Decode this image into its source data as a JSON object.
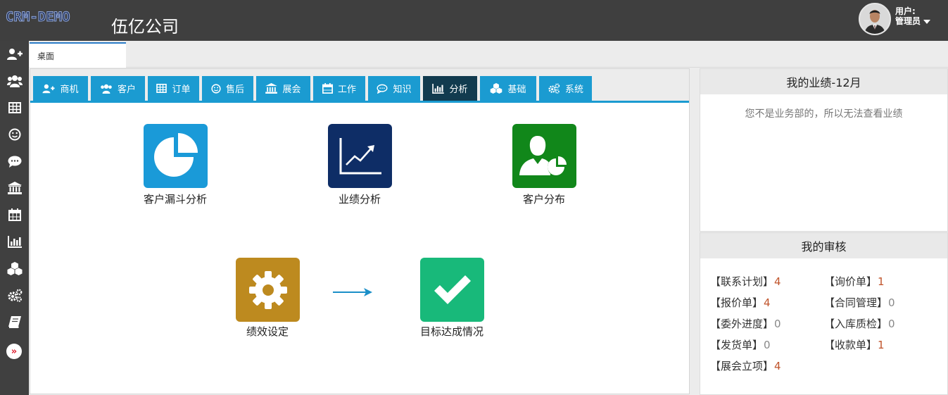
{
  "header": {
    "logo": "CRM-DEMO",
    "company": "伍亿公司",
    "user_label": "用户:",
    "user_name": "管理员"
  },
  "rail": {
    "icons": [
      "user-plus-icon",
      "users-icon",
      "table-icon",
      "smile-icon",
      "comment-icon",
      "bank-icon",
      "calendar-icon",
      "bar-chart-icon",
      "cubes-icon",
      "cogs-icon",
      "book-icon"
    ],
    "toggle": "»"
  },
  "tabs": {
    "desktop": "桌面"
  },
  "modules": [
    {
      "label": "商机",
      "icon": "user-plus-icon"
    },
    {
      "label": "客户",
      "icon": "users-icon"
    },
    {
      "label": "订单",
      "icon": "table-icon"
    },
    {
      "label": "售后",
      "icon": "smile-icon"
    },
    {
      "label": "展会",
      "icon": "bank-icon"
    },
    {
      "label": "工作",
      "icon": "calendar-icon"
    },
    {
      "label": "知识",
      "icon": "comment-icon"
    },
    {
      "label": "分析",
      "icon": "bar-chart-icon",
      "active": true
    },
    {
      "label": "基础",
      "icon": "cubes-icon"
    },
    {
      "label": "系统",
      "icon": "cogs-icon"
    }
  ],
  "analysis": {
    "funnel": "客户漏斗分析",
    "performance": "业绩分析",
    "distribution": "客户分布",
    "kpi_setting": "绩效设定",
    "target_status": "目标达成情况"
  },
  "colors": {
    "funnel": "#1a9ad8",
    "performance": "#0e2d66",
    "distribution": "#11871a",
    "kpi_setting": "#bd8a1f",
    "target_status": "#18b97a",
    "tab": "#1b9bd1",
    "tab_active": "#123b4f"
  },
  "performance_panel": {
    "title": "我的业绩-12月",
    "message": "您不是业务部的，所以无法查看业绩"
  },
  "review_panel": {
    "title": "我的审核",
    "items": [
      {
        "label": "【联系计划】",
        "count": "4"
      },
      {
        "label": "【询价单】",
        "count": "1"
      },
      {
        "label": "【报价单】",
        "count": "4"
      },
      {
        "label": "【合同管理】",
        "count": "0"
      },
      {
        "label": "【委外进度】",
        "count": "0"
      },
      {
        "label": "【入库质检】",
        "count": "0"
      },
      {
        "label": "【发货单】",
        "count": "0"
      },
      {
        "label": "【收款单】",
        "count": "1"
      },
      {
        "label": "【展会立项】",
        "count": "4"
      }
    ]
  }
}
